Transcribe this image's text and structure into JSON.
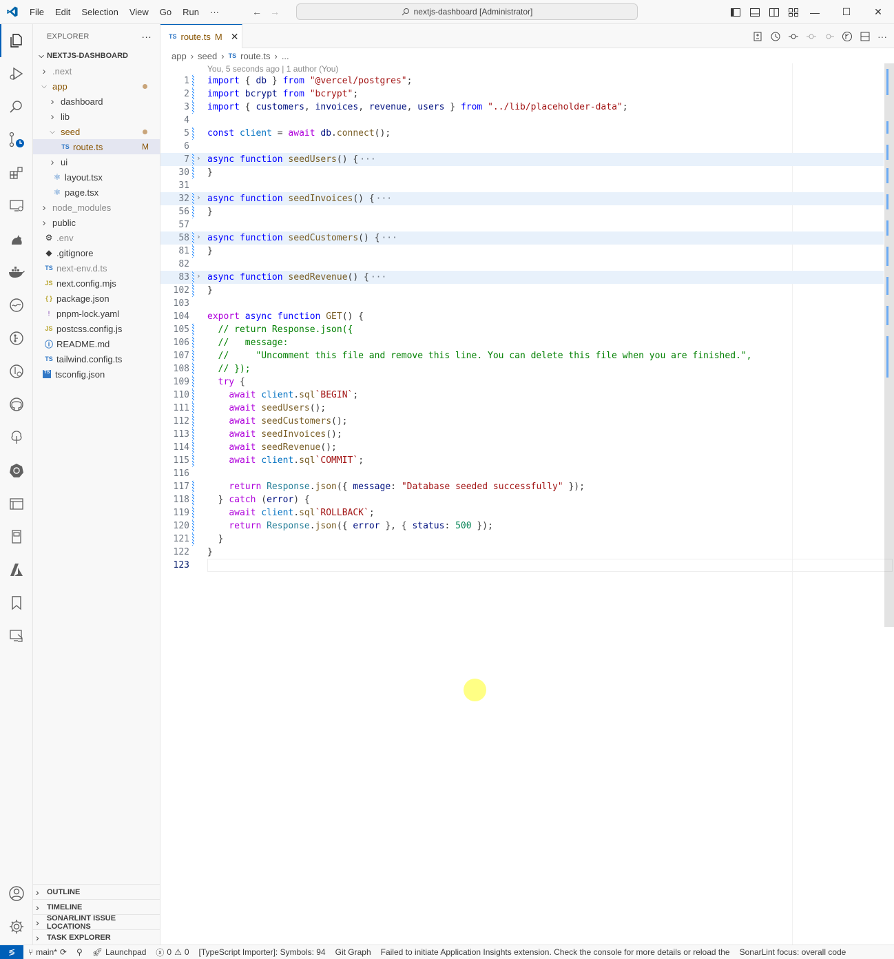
{
  "titlebar": {
    "menu": [
      "File",
      "Edit",
      "Selection",
      "View",
      "Go",
      "Run"
    ],
    "more": "···",
    "command_center": "nextjs-dashboard [Administrator]"
  },
  "sidebar": {
    "title": "EXPLORER",
    "more": "···",
    "root": "NEXTJS-DASHBOARD",
    "tree": [
      {
        "label": ".next",
        "depth": 1,
        "kind": "folder",
        "open": false,
        "style": "gray"
      },
      {
        "label": "app",
        "depth": 1,
        "kind": "folder",
        "open": true,
        "style": "mod",
        "dot": true
      },
      {
        "label": "dashboard",
        "depth": 2,
        "kind": "folder",
        "open": false
      },
      {
        "label": "lib",
        "depth": 2,
        "kind": "folder",
        "open": false
      },
      {
        "label": "seed",
        "depth": 2,
        "kind": "folder",
        "open": true,
        "style": "mod",
        "dot": true
      },
      {
        "label": "route.ts",
        "depth": 3,
        "kind": "ts",
        "style": "mod",
        "mark": "M",
        "selected": true
      },
      {
        "label": "ui",
        "depth": 2,
        "kind": "folder",
        "open": false
      },
      {
        "label": "layout.tsx",
        "depth": 2,
        "kind": "react"
      },
      {
        "label": "page.tsx",
        "depth": 2,
        "kind": "react"
      },
      {
        "label": "node_modules",
        "depth": 1,
        "kind": "folder",
        "open": false,
        "style": "gray"
      },
      {
        "label": "public",
        "depth": 1,
        "kind": "folder",
        "open": false
      },
      {
        "label": ".env",
        "depth": 1,
        "kind": "gear",
        "style": "gray"
      },
      {
        "label": ".gitignore",
        "depth": 1,
        "kind": "git"
      },
      {
        "label": "next-env.d.ts",
        "depth": 1,
        "kind": "ts",
        "style": "gray"
      },
      {
        "label": "next.config.mjs",
        "depth": 1,
        "kind": "js"
      },
      {
        "label": "package.json",
        "depth": 1,
        "kind": "json"
      },
      {
        "label": "pnpm-lock.yaml",
        "depth": 1,
        "kind": "yaml"
      },
      {
        "label": "postcss.config.js",
        "depth": 1,
        "kind": "js"
      },
      {
        "label": "README.md",
        "depth": 1,
        "kind": "info"
      },
      {
        "label": "tailwind.config.ts",
        "depth": 1,
        "kind": "ts"
      },
      {
        "label": "tsconfig.json",
        "depth": 1,
        "kind": "tsjson"
      }
    ],
    "panes": [
      "OUTLINE",
      "TIMELINE",
      "SONARLINT ISSUE LOCATIONS",
      "TASK EXPLORER"
    ]
  },
  "editor": {
    "tab": {
      "label": "route.ts",
      "badge": "M",
      "icon": "TS"
    },
    "breadcrumb": [
      "app",
      "seed",
      "route.ts",
      "..."
    ],
    "blame": "You, 5 seconds ago | 1 author (You)",
    "lines": [
      {
        "n": "1",
        "bar": true,
        "tokens": [
          [
            "kw",
            "import"
          ],
          [
            "txt",
            " { "
          ],
          [
            "var",
            "db"
          ],
          [
            "txt",
            " } "
          ],
          [
            "kw",
            "from"
          ],
          [
            "txt",
            " "
          ],
          [
            "str",
            "\"@vercel/postgres\""
          ],
          [
            "txt",
            ";"
          ]
        ]
      },
      {
        "n": "2",
        "bar": true,
        "tokens": [
          [
            "kw",
            "import"
          ],
          [
            "txt",
            " "
          ],
          [
            "var",
            "bcrypt"
          ],
          [
            "txt",
            " "
          ],
          [
            "kw",
            "from"
          ],
          [
            "txt",
            " "
          ],
          [
            "str",
            "\"bcrypt\""
          ],
          [
            "txt",
            ";"
          ]
        ]
      },
      {
        "n": "3",
        "bar": true,
        "tokens": [
          [
            "kw",
            "import"
          ],
          [
            "txt",
            " { "
          ],
          [
            "var",
            "customers"
          ],
          [
            "txt",
            ", "
          ],
          [
            "var",
            "invoices"
          ],
          [
            "txt",
            ", "
          ],
          [
            "var",
            "revenue"
          ],
          [
            "txt",
            ", "
          ],
          [
            "var",
            "users"
          ],
          [
            "txt",
            " } "
          ],
          [
            "kw",
            "from"
          ],
          [
            "txt",
            " "
          ],
          [
            "str",
            "\"../lib/placeholder-data\""
          ],
          [
            "txt",
            ";"
          ]
        ]
      },
      {
        "n": "4",
        "bar": false,
        "tokens": []
      },
      {
        "n": "5",
        "bar": true,
        "tokens": [
          [
            "kw",
            "const"
          ],
          [
            "txt",
            " "
          ],
          [
            "cn",
            "client"
          ],
          [
            "txt",
            " = "
          ],
          [
            "ctl",
            "await"
          ],
          [
            "txt",
            " "
          ],
          [
            "var",
            "db"
          ],
          [
            "txt",
            "."
          ],
          [
            "fn",
            "connect"
          ],
          [
            "txt",
            "();"
          ]
        ]
      },
      {
        "n": "6",
        "bar": false,
        "tokens": []
      },
      {
        "n": "7",
        "bar": true,
        "fold": true,
        "tokens": [
          [
            "kw",
            "async"
          ],
          [
            "txt",
            " "
          ],
          [
            "kw",
            "function"
          ],
          [
            "txt",
            " "
          ],
          [
            "fn",
            "seedUsers"
          ],
          [
            "txt",
            "() {"
          ],
          [
            "ell",
            "···"
          ]
        ]
      },
      {
        "n": "30",
        "bar": true,
        "tokens": [
          [
            "txt",
            "}"
          ]
        ]
      },
      {
        "n": "31",
        "bar": false,
        "tokens": []
      },
      {
        "n": "32",
        "bar": true,
        "fold": true,
        "tokens": [
          [
            "kw",
            "async"
          ],
          [
            "txt",
            " "
          ],
          [
            "kw",
            "function"
          ],
          [
            "txt",
            " "
          ],
          [
            "fn",
            "seedInvoices"
          ],
          [
            "txt",
            "() {"
          ],
          [
            "ell",
            "···"
          ]
        ]
      },
      {
        "n": "56",
        "bar": true,
        "tokens": [
          [
            "txt",
            "}"
          ]
        ]
      },
      {
        "n": "57",
        "bar": false,
        "tokens": []
      },
      {
        "n": "58",
        "bar": true,
        "fold": true,
        "tokens": [
          [
            "kw",
            "async"
          ],
          [
            "txt",
            " "
          ],
          [
            "kw",
            "function"
          ],
          [
            "txt",
            " "
          ],
          [
            "fn",
            "seedCustomers"
          ],
          [
            "txt",
            "() {"
          ],
          [
            "ell",
            "···"
          ]
        ]
      },
      {
        "n": "81",
        "bar": true,
        "tokens": [
          [
            "txt",
            "}"
          ]
        ]
      },
      {
        "n": "82",
        "bar": false,
        "tokens": []
      },
      {
        "n": "83",
        "bar": true,
        "fold": true,
        "tokens": [
          [
            "kw",
            "async"
          ],
          [
            "txt",
            " "
          ],
          [
            "kw",
            "function"
          ],
          [
            "txt",
            " "
          ],
          [
            "fn",
            "seedRevenue"
          ],
          [
            "txt",
            "() {"
          ],
          [
            "ell",
            "···"
          ]
        ]
      },
      {
        "n": "102",
        "bar": true,
        "tokens": [
          [
            "txt",
            "}"
          ]
        ]
      },
      {
        "n": "103",
        "bar": false,
        "tokens": []
      },
      {
        "n": "104",
        "bar": false,
        "tokens": [
          [
            "ctl",
            "export"
          ],
          [
            "txt",
            " "
          ],
          [
            "kw",
            "async"
          ],
          [
            "txt",
            " "
          ],
          [
            "kw",
            "function"
          ],
          [
            "txt",
            " "
          ],
          [
            "fn",
            "GET"
          ],
          [
            "txt",
            "() {"
          ]
        ]
      },
      {
        "n": "105",
        "bar": true,
        "tokens": [
          [
            "txt",
            "  "
          ],
          [
            "com",
            "// return Response.json({"
          ]
        ]
      },
      {
        "n": "106",
        "bar": true,
        "tokens": [
          [
            "txt",
            "  "
          ],
          [
            "com",
            "//   message:"
          ]
        ]
      },
      {
        "n": "107",
        "bar": true,
        "tokens": [
          [
            "txt",
            "  "
          ],
          [
            "com",
            "//     \"Uncomment this file and remove this line. You can delete this file when you are finished.\","
          ]
        ]
      },
      {
        "n": "108",
        "bar": true,
        "tokens": [
          [
            "txt",
            "  "
          ],
          [
            "com",
            "// });"
          ]
        ]
      },
      {
        "n": "109",
        "bar": true,
        "tokens": [
          [
            "txt",
            "  "
          ],
          [
            "ctl",
            "try"
          ],
          [
            "txt",
            " {"
          ]
        ]
      },
      {
        "n": "110",
        "bar": true,
        "tokens": [
          [
            "txt",
            "    "
          ],
          [
            "ctl",
            "await"
          ],
          [
            "txt",
            " "
          ],
          [
            "cn",
            "client"
          ],
          [
            "txt",
            "."
          ],
          [
            "fn",
            "sql"
          ],
          [
            "str",
            "`BEGIN`"
          ],
          [
            "txt",
            ";"
          ]
        ]
      },
      {
        "n": "111",
        "bar": true,
        "tokens": [
          [
            "txt",
            "    "
          ],
          [
            "ctl",
            "await"
          ],
          [
            "txt",
            " "
          ],
          [
            "fn",
            "seedUsers"
          ],
          [
            "txt",
            "();"
          ]
        ]
      },
      {
        "n": "112",
        "bar": true,
        "tokens": [
          [
            "txt",
            "    "
          ],
          [
            "ctl",
            "await"
          ],
          [
            "txt",
            " "
          ],
          [
            "fn",
            "seedCustomers"
          ],
          [
            "txt",
            "();"
          ]
        ]
      },
      {
        "n": "113",
        "bar": true,
        "tokens": [
          [
            "txt",
            "    "
          ],
          [
            "ctl",
            "await"
          ],
          [
            "txt",
            " "
          ],
          [
            "fn",
            "seedInvoices"
          ],
          [
            "txt",
            "();"
          ]
        ]
      },
      {
        "n": "114",
        "bar": true,
        "tokens": [
          [
            "txt",
            "    "
          ],
          [
            "ctl",
            "await"
          ],
          [
            "txt",
            " "
          ],
          [
            "fn",
            "seedRevenue"
          ],
          [
            "txt",
            "();"
          ]
        ]
      },
      {
        "n": "115",
        "bar": true,
        "tokens": [
          [
            "txt",
            "    "
          ],
          [
            "ctl",
            "await"
          ],
          [
            "txt",
            " "
          ],
          [
            "cn",
            "client"
          ],
          [
            "txt",
            "."
          ],
          [
            "fn",
            "sql"
          ],
          [
            "str",
            "`COMMIT`"
          ],
          [
            "txt",
            ";"
          ]
        ]
      },
      {
        "n": "116",
        "bar": false,
        "tokens": []
      },
      {
        "n": "117",
        "bar": true,
        "tokens": [
          [
            "txt",
            "    "
          ],
          [
            "ctl",
            "return"
          ],
          [
            "txt",
            " "
          ],
          [
            "cls",
            "Response"
          ],
          [
            "txt",
            "."
          ],
          [
            "fn",
            "json"
          ],
          [
            "txt",
            "({ "
          ],
          [
            "var",
            "message"
          ],
          [
            "txt",
            ": "
          ],
          [
            "str",
            "\"Database seeded successfully\""
          ],
          [
            "txt",
            " });"
          ]
        ]
      },
      {
        "n": "118",
        "bar": true,
        "tokens": [
          [
            "txt",
            "  } "
          ],
          [
            "ctl",
            "catch"
          ],
          [
            "txt",
            " ("
          ],
          [
            "var",
            "error"
          ],
          [
            "txt",
            ") {"
          ]
        ]
      },
      {
        "n": "119",
        "bar": true,
        "tokens": [
          [
            "txt",
            "    "
          ],
          [
            "ctl",
            "await"
          ],
          [
            "txt",
            " "
          ],
          [
            "cn",
            "client"
          ],
          [
            "txt",
            "."
          ],
          [
            "fn",
            "sql"
          ],
          [
            "str",
            "`ROLLBACK`"
          ],
          [
            "txt",
            ";"
          ]
        ]
      },
      {
        "n": "120",
        "bar": true,
        "tokens": [
          [
            "txt",
            "    "
          ],
          [
            "ctl",
            "return"
          ],
          [
            "txt",
            " "
          ],
          [
            "cls",
            "Response"
          ],
          [
            "txt",
            "."
          ],
          [
            "fn",
            "json"
          ],
          [
            "txt",
            "({ "
          ],
          [
            "var",
            "error"
          ],
          [
            "txt",
            " }, { "
          ],
          [
            "var",
            "status"
          ],
          [
            "txt",
            ": "
          ],
          [
            "num",
            "500"
          ],
          [
            "txt",
            " });"
          ]
        ]
      },
      {
        "n": "121",
        "bar": true,
        "tokens": [
          [
            "txt",
            "  }"
          ]
        ]
      },
      {
        "n": "122",
        "bar": false,
        "tokens": [
          [
            "txt",
            "}"
          ]
        ]
      },
      {
        "n": "123",
        "bar": false,
        "current": true,
        "tokens": []
      }
    ]
  },
  "statusbar": {
    "branch": "main*",
    "launchpad": "Launchpad",
    "errors": "0",
    "warnings": "0",
    "ts_importer": "[TypeScript Importer]: Symbols: 94",
    "git_graph": "Git Graph",
    "app_insights": "Failed to initiate Application Insights extension. Check the console for more details or reload the",
    "sonarlint": "SonarLint focus: overall code"
  },
  "colors": {
    "accent": "#005fb8",
    "modified": "#895503",
    "folded_bg": "#e8f1fb"
  }
}
